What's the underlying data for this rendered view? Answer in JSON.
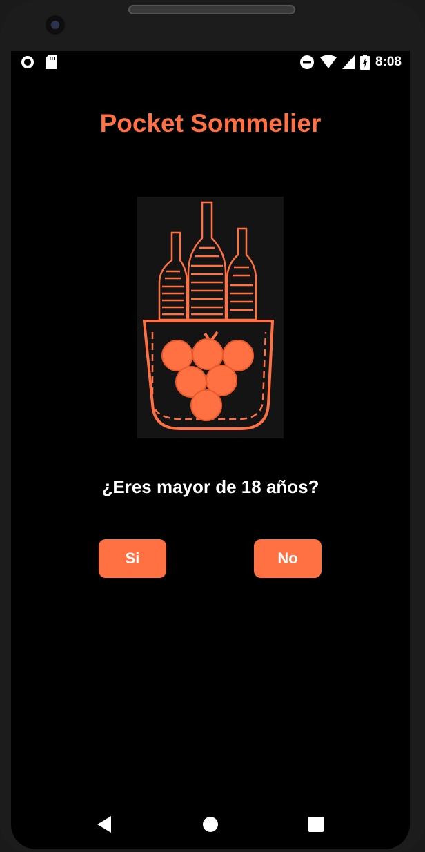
{
  "status_bar": {
    "time": "8:08",
    "icons_left": [
      "record-icon",
      "sd-card-icon"
    ],
    "icons_right": [
      "do-not-disturb-icon",
      "wifi-icon",
      "signal-icon",
      "battery-charging-icon"
    ]
  },
  "app": {
    "title": "Pocket Sommelier",
    "logo_icon": "wine-bottles-pocket-grapes-logo",
    "question": "¿Eres mayor de 18 años?",
    "yes_label": "Si",
    "no_label": "No"
  },
  "nav_bar": {
    "icons": [
      "back-icon",
      "home-icon",
      "recents-icon"
    ]
  },
  "colors": {
    "accent": "#ff7043",
    "background": "#000000",
    "text": "#ffffff"
  }
}
